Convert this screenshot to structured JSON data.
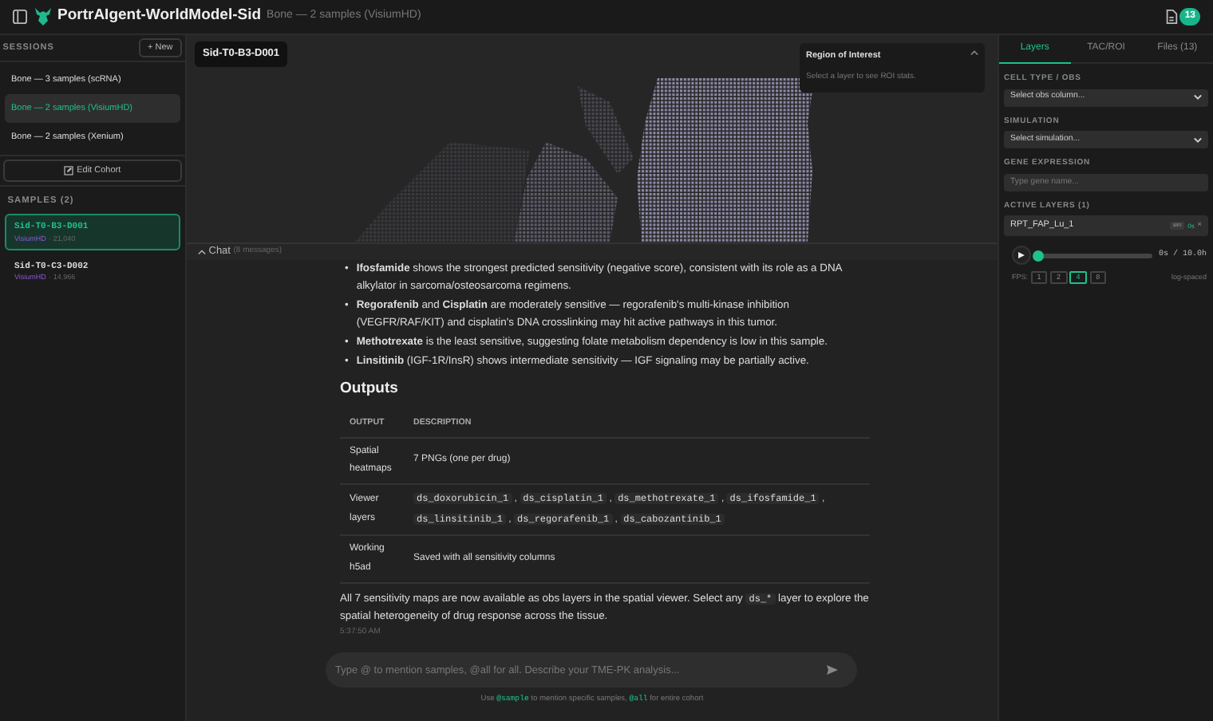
{
  "header": {
    "title": "PortrAIgent-WorldModel-Sid",
    "subtitle": "Bone — 2 samples (VisiumHD)",
    "badge": "13"
  },
  "sidebar": {
    "sessions_heading": "SESSIONS",
    "new_button": "+ New",
    "sessions": [
      {
        "label": "Bone — 3 samples (scRNA)",
        "selected": false
      },
      {
        "label": "Bone — 2 samples (VisiumHD)",
        "selected": true
      },
      {
        "label": "Bone — 2 samples (Xenium)",
        "selected": false
      }
    ],
    "edit_cohort": "Edit Cohort",
    "samples_heading": "SAMPLES (2)",
    "samples": [
      {
        "id": "Sid-T0-B3-D001",
        "platform": "VisiumHD",
        "count": "· 21,040",
        "selected": true
      },
      {
        "id": "Sid-T0-C3-D002",
        "platform": "VisiumHD",
        "count": "· 14,966",
        "selected": false
      }
    ]
  },
  "viewer": {
    "sample_label": "Sid-T0-B3-D001",
    "roi": {
      "title": "Region of Interest",
      "hint": "Select a layer to see ROI stats."
    }
  },
  "chat": {
    "label": "Chat",
    "count": "(8 messages)",
    "bullet_marker": "•",
    "bullets": [
      "**Ifosfamide** shows the strongest predicted sensitivity (negative score), consistent with its role as a DNA alkylator in sarcoma/osteosarcoma regimens.",
      "**Regorafenib** and **Cisplatin** are moderately sensitive — regorafenib's multi-kinase inhibition (VEGFR/RAF/KIT) and cisplatin's DNA crosslinking may hit active pathways in this tumor.",
      "**Methotrexate** is the least sensitive, suggesting folate metabolism dependency is low in this sample.",
      "**Linsitinib** (IGF-1R/InsR) shows intermediate sensitivity — IGF signaling may be partially active."
    ],
    "outputs_heading": "Outputs",
    "columns": [
      "OUTPUT",
      "DESCRIPTION"
    ],
    "rows": [
      {
        "output": "Spatial heatmaps",
        "kind": "text",
        "description": "7 PNGs (one per drug)"
      },
      {
        "output": "Viewer layers",
        "kind": "codes",
        "separator": ",",
        "codes": [
          "ds_doxorubicin_1",
          "ds_cisplatin_1",
          "ds_methotrexate_1",
          "ds_ifosfamide_1",
          "ds_linsitinib_1",
          "ds_regorafenib_1",
          "ds_cabozantinib_1"
        ]
      },
      {
        "output": "Working h5ad",
        "kind": "text",
        "description": "Saved with all sensitivity columns"
      }
    ],
    "closing": {
      "before": "All 7 sensitivity maps are now available as obs layers in the spatial viewer. Select any",
      "code": "ds_*",
      "after": "layer to explore the spatial heterogeneity of drug response across the tissue."
    },
    "timestamp": "5:37:50 AM",
    "input_placeholder": "Type @ to mention samples, @all for all. Describe your TME-PK analysis...",
    "hint": {
      "before": "Use",
      "code1": "@sample",
      "middle": "to mention specific samples,",
      "code2": "@all",
      "after": "for entire cohort"
    }
  },
  "panel": {
    "tabs": [
      {
        "label": "Layers",
        "selected": true
      },
      {
        "label": "TAC/ROI",
        "selected": false
      },
      {
        "label": "Files (13)",
        "selected": false
      }
    ],
    "cell_type": {
      "label": "CELL TYPE / OBS",
      "placeholder": "Select obs column..."
    },
    "simulation": {
      "label": "SIMULATION",
      "placeholder": "Select simulation..."
    },
    "gene": {
      "label": "GENE EXPRESSION",
      "placeholder": "Type gene name..."
    },
    "active_heading": "ACTIVE LAYERS (1)",
    "layer": {
      "name": "RPT_FAP_Lu_1",
      "tag": "sim",
      "time": "0s",
      "remove": "×"
    },
    "player": {
      "level": 0,
      "time": "0s / 10.0h",
      "fps_label": "FPS:",
      "fps": [
        {
          "label": "1",
          "selected": false
        },
        {
          "label": "2",
          "selected": false
        },
        {
          "label": "4",
          "selected": true
        },
        {
          "label": "8",
          "selected": false
        }
      ],
      "scale": "log-spaced"
    }
  }
}
